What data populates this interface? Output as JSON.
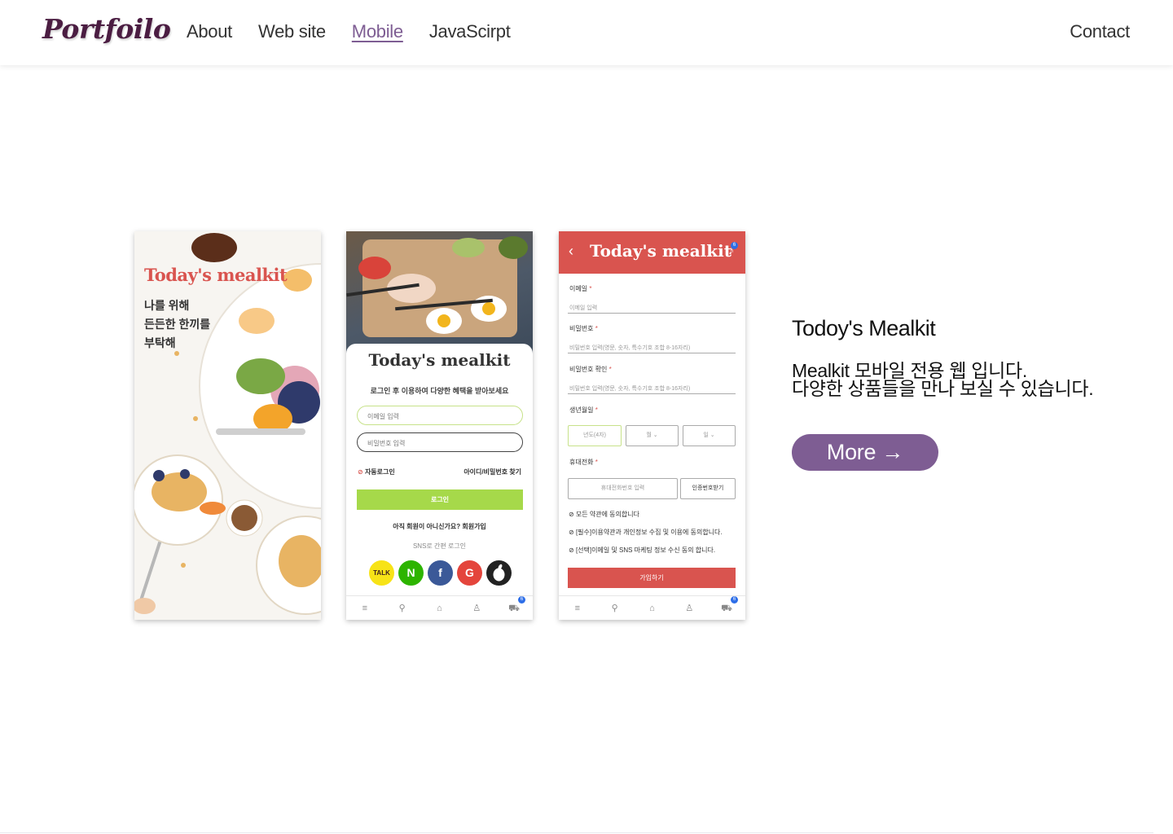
{
  "header": {
    "logo": "Portfoilo",
    "nav": [
      {
        "label": "About",
        "active": false
      },
      {
        "label": "Web site",
        "active": false
      },
      {
        "label": "Mobile",
        "active": true
      },
      {
        "label": "JavaScirpt",
        "active": false
      }
    ],
    "contact": "Contact",
    "active_color": "#7e5d93"
  },
  "phones": {
    "splash": {
      "title": "Today's mealkit",
      "lines": [
        "나를 위해",
        "든든한 한끼를",
        "부탁해"
      ]
    },
    "login": {
      "title": "Today's mealkit",
      "subtitle": "로그인 후 이용하여 다양한 혜택을 받아보세요",
      "email_placeholder": "이메일 입력",
      "password_placeholder": "비밀번호 입력",
      "auto_login": "자동로그인",
      "find": "아이디/비밀번호 찾기",
      "login_button": "로그인",
      "join_text": "아직 회원이 아니신가요? 회원가입",
      "sns_label": "SNS로 간편 로그인",
      "sns": [
        {
          "label": "TALK",
          "color": "#f7e317",
          "text_color": "#3b1e1e",
          "icon": "kakao-icon"
        },
        {
          "label": "N",
          "color": "#2db400",
          "text_color": "#ffffff",
          "icon": "naver-icon"
        },
        {
          "label": "f",
          "color": "#3b5998",
          "text_color": "#ffffff",
          "icon": "facebook-icon"
        },
        {
          "label": "G",
          "color": "#e4453c",
          "text_color": "#ffffff",
          "icon": "google-icon"
        },
        {
          "label": "",
          "color": "#222222",
          "text_color": "#ffffff",
          "icon": "apple-icon"
        }
      ],
      "cart_badge": "6"
    },
    "signup": {
      "title": "Today's mealkit",
      "bell_badge": "6",
      "email_label": "이메일",
      "email_placeholder": "이메일 입력",
      "password_label": "비밀번호",
      "password_placeholder": "비밀번호 입력(영문, 숫자, 특수기호 조합 8-16자리)",
      "password_confirm_label": "비밀번호 확인",
      "password_confirm_placeholder": "비밀번호 입력(영문, 숫자, 특수기호 조합 8-16자리)",
      "birth_label": "생년월일",
      "year": "년도(4자)",
      "month": "월",
      "day": "일",
      "phone_label": "휴대전화",
      "phone_placeholder": "휴대전화번호 입력",
      "verify_button": "인증번호받기",
      "checks": [
        "모든 약관에 동의합니다",
        "[필수]이용약관과 개인정보 수집 및 이용에 동의합니다.",
        "[선택]이메일 및 SNS 마케팅 정보 수신 동의 합니다."
      ],
      "submit": "가입하기",
      "cart_badge": "6"
    },
    "accent": "#d9544f"
  },
  "project": {
    "title": "Todoy's Mealkit",
    "desc": [
      "Mealkit 모바일 전용 웹 입니다.",
      "다양한 상품들을 만나 보실 수 있습니다."
    ],
    "more": "More →"
  }
}
